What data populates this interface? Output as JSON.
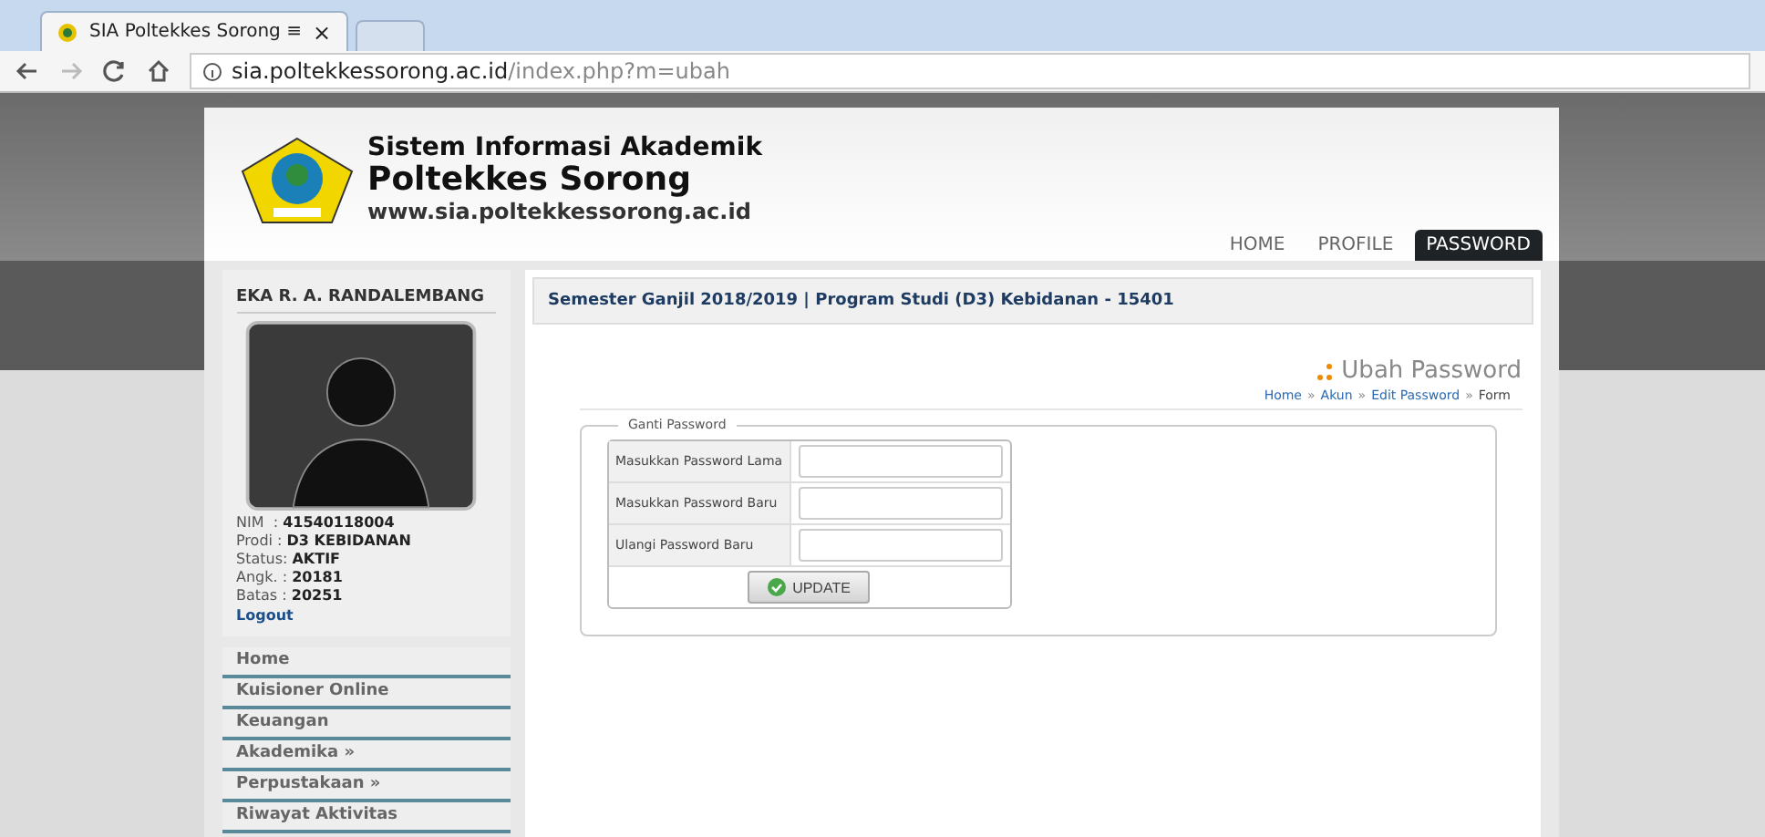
{
  "browser": {
    "tabs": [
      {
        "title": "SIA Poltekkes Sorong ≡",
        "close": "×",
        "selected": true
      }
    ],
    "url_host": "sia.poltekkessorong.ac.id",
    "url_path": "/index.php?m=ubah"
  },
  "header": {
    "title": "Sistem Informasi Akademik",
    "subtitle": "Poltekkes Sorong",
    "website": "www.sia.poltekkessorong.ac.id",
    "nav": [
      {
        "label": "HOME",
        "selected": false
      },
      {
        "label": "PROFILE",
        "selected": false
      },
      {
        "label": "PASSWORD",
        "selected": true
      }
    ]
  },
  "profile": {
    "name": "EKA R. A. RANDALEMBANG",
    "details": [
      "NIM  : **41540118004**",
      "Prodi : **D3 KEBIDANAN**",
      "Status: **AKTIF**",
      "Angk. : **20181**",
      "Batas : **20251**"
    ],
    "logout": "Logout"
  },
  "menu": [
    "Home",
    "Kuisioner Online",
    "Keuangan",
    "Akademika »",
    "Perpustakaan »",
    "Riwayat Aktivitas"
  ],
  "semester_bar": "Semester Ganjil 2018/2019 | Program Studi (D3) Kebidanan - 15401",
  "page_title": "Ubah Password",
  "breadcrumb": [
    {
      "label": "Home",
      "link": true
    },
    {
      "label": "Akun",
      "link": true
    },
    {
      "label": "Edit Password",
      "link": true
    },
    {
      "label": "Form",
      "link": false
    }
  ],
  "breadcrumb_separator": "»",
  "form": {
    "legend": "Ganti Password",
    "fields": [
      {
        "label": "Masukkan Password Lama"
      },
      {
        "label": "Masukkan Password Baru"
      },
      {
        "label": "Ulangi Password Baru"
      }
    ],
    "submit": "UPDATE"
  }
}
